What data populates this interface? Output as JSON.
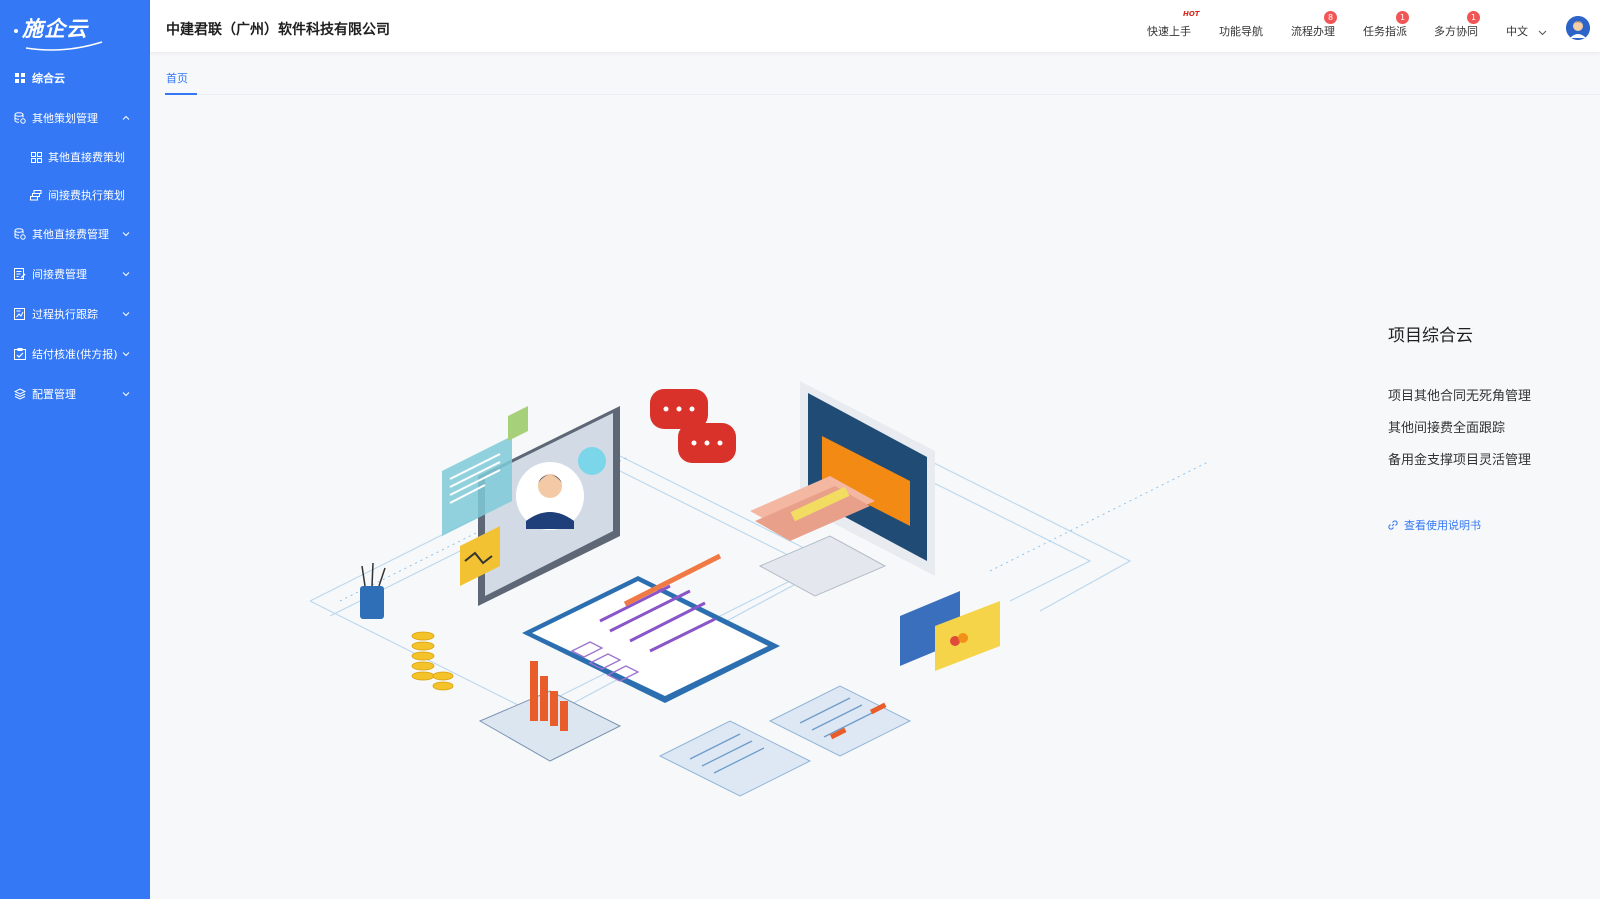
{
  "app": {
    "logo": "施企云",
    "company": "中建君联（广州）软件科技有限公司"
  },
  "sidebar": {
    "items": [
      {
        "label": "综合云",
        "icon": "grid-icon"
      },
      {
        "label": "其他策划管理",
        "icon": "database-icon",
        "expanded": true
      },
      {
        "label": "其他直接费策划",
        "icon": "apps-icon",
        "sub": true
      },
      {
        "label": "间接费执行策划",
        "icon": "coins-icon",
        "sub": true
      },
      {
        "label": "其他直接费管理",
        "icon": "database-icon"
      },
      {
        "label": "间接费管理",
        "icon": "edit-list-icon"
      },
      {
        "label": "过程执行跟踪",
        "icon": "report-icon"
      },
      {
        "label": "结付核准(供方报)",
        "icon": "check-clipboard-icon"
      },
      {
        "label": "配置管理",
        "icon": "layers-icon"
      }
    ]
  },
  "header": {
    "nav": [
      {
        "label": "快速上手",
        "hot": "HOT"
      },
      {
        "label": "功能导航"
      },
      {
        "label": "流程办理",
        "badge": "8"
      },
      {
        "label": "任务指派",
        "badge": "1"
      },
      {
        "label": "多方协同",
        "badge": "1"
      }
    ],
    "language": "中文"
  },
  "tabs": [
    {
      "label": "首页",
      "active": true
    }
  ],
  "info": {
    "title": "项目综合云",
    "lines": [
      "项目其他合同无死角管理",
      "其他间接费全面跟踪",
      "备用金支撑项目灵活管理"
    ],
    "guide_link": "查看使用说明书"
  },
  "colors": {
    "primary": "#3478f6",
    "badge": "#f25555",
    "hot": "#d7281e"
  }
}
